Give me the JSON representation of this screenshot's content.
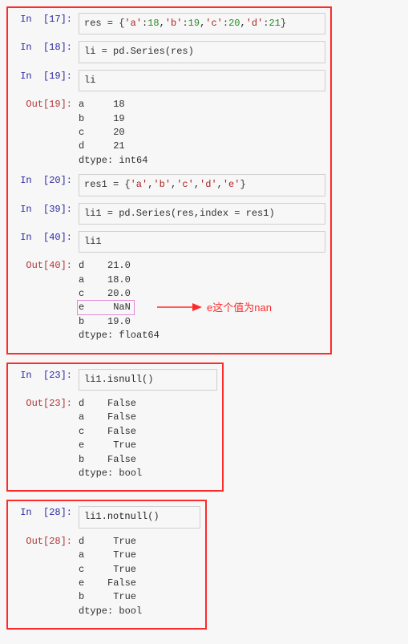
{
  "annotation": "e这个值为nan",
  "prompts": {
    "in17": "In  [17]:",
    "in18": "In  [18]:",
    "in19": "In  [19]:",
    "out19": "Out[19]:",
    "in20": "In  [20]:",
    "in39": "In  [39]:",
    "in40": "In  [40]:",
    "out40": "Out[40]:",
    "in23": "In  [23]:",
    "out23": "Out[23]:",
    "in28": "In  [28]:",
    "out28": "Out[28]:"
  },
  "code17": {
    "pre": "res = {",
    "s1": "'a'",
    "n1": "18",
    "s2": "'b'",
    "n2": "19",
    "s3": "'c'",
    "n3": "20",
    "s4": "'d'",
    "n4": "21",
    "post": "}",
    "colon": ":",
    "comma": ","
  },
  "code18": "li = pd.Series(res)",
  "code19": "li",
  "out19": "a     18\nb     19\nc     20\nd     21\ndtype: int64",
  "code20": {
    "pre": "res1 = {",
    "s1": "'a'",
    "s2": "'b'",
    "s3": "'c'",
    "s4": "'d'",
    "s5": "'e'",
    "post": "}",
    "comma": ","
  },
  "code39": "li1 = pd.Series(res,index = res1)",
  "code40": "li1",
  "out40": "d    21.0\na    18.0\nc    20.0\ne     NaN\nb    19.0\ndtype: float64",
  "code23": {
    "obj": "li1.",
    "fn": "isnull",
    "rest": "()"
  },
  "out23": "d    False\na    False\nc    False\ne     True\nb    False\ndtype: bool",
  "code28": {
    "obj": "li1.",
    "fn": "notnull",
    "rest": "()"
  },
  "out28": "d     True\na     True\nc     True\ne    False\nb     True\ndtype: bool"
}
